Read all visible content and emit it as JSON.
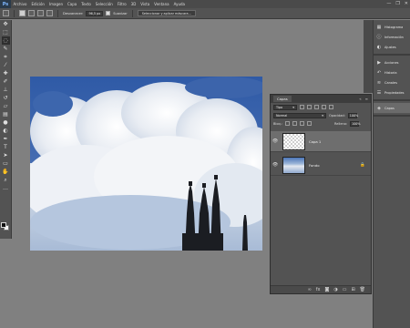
{
  "app": {
    "logo": "Ps"
  },
  "menu": [
    "Archivo",
    "Edición",
    "Imagen",
    "Capa",
    "Texto",
    "Selección",
    "Filtro",
    "3D",
    "Vista",
    "Ventana",
    "Ayuda"
  ],
  "window_controls": {
    "minimize": "—",
    "restore": "❐",
    "close": "✕"
  },
  "options": {
    "feather_label": "Desvanecer:",
    "feather_value": "96,5 px",
    "smooth_label": "Suavizar",
    "select_mask_button": "Seleccionar y aplicar máscara..."
  },
  "tools": [
    "move-icon",
    "marquee-icon",
    "lasso-icon",
    "quick-select-icon",
    "crop-icon",
    "eyedropper-icon",
    "healing-icon",
    "brush-icon",
    "stamp-icon",
    "history-brush-icon",
    "eraser-icon",
    "gradient-icon",
    "blur-icon",
    "dodge-icon",
    "pen-icon",
    "type-icon",
    "path-select-icon",
    "shape-icon",
    "hand-icon",
    "zoom-icon",
    "more-icon"
  ],
  "layers_panel": {
    "tab": "Capas",
    "filter_kind": "Tipo",
    "blend_mode": "Normal",
    "opacity_label": "Opacidad:",
    "opacity_value": "100%",
    "lock_label": "Bloq.:",
    "fill_label": "Relleno:",
    "fill_value": "100%",
    "layers": [
      {
        "name": "Capa 1",
        "visible": true,
        "selected": true
      },
      {
        "name": "Fondo",
        "visible": true,
        "selected": false,
        "locked": true
      }
    ]
  },
  "dock": {
    "group1": [
      {
        "label": "Histograma",
        "icon": "histogram-icon"
      },
      {
        "label": "Información",
        "icon": "info-icon"
      },
      {
        "label": "Ajustes",
        "icon": "adjustments-icon"
      }
    ],
    "group2": [
      {
        "label": "Acciones",
        "icon": "actions-icon"
      },
      {
        "label": "Historia",
        "icon": "history-icon"
      },
      {
        "label": "Canales",
        "icon": "channels-icon"
      },
      {
        "label": "Propiedades",
        "icon": "properties-icon"
      }
    ],
    "group3": [
      {
        "label": "Capas",
        "icon": "layers-icon"
      }
    ]
  },
  "colors": {
    "menubar": "#4a4a4a",
    "panel": "#535353",
    "workspace": "#808080",
    "sky": "#3f64a8"
  }
}
